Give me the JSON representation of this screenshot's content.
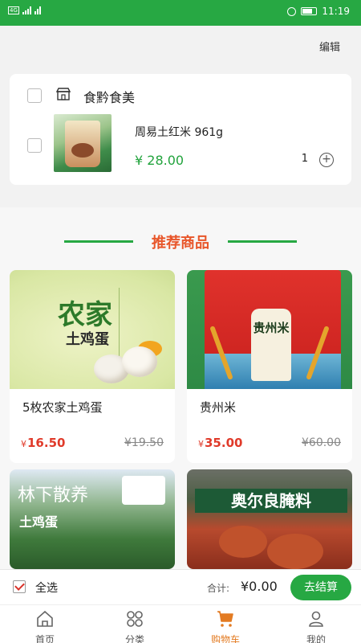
{
  "status_bar": {
    "time": "11:19",
    "network": "4G",
    "battery_label": "battery"
  },
  "header": {
    "edit_label": "编辑"
  },
  "cart": {
    "shop_name": "食黔食美",
    "items": [
      {
        "name": "周易土红米 961g",
        "price": "¥ 28.00",
        "quantity": "1",
        "plus": "+"
      }
    ]
  },
  "recommend": {
    "title": "推荐商品",
    "goods": [
      {
        "name": "5枚农家土鸡蛋",
        "price_symbol": "¥",
        "price": "16.50",
        "old_price": "¥19.50",
        "img_text_main": "农家",
        "img_text_sub": "土鸡蛋"
      },
      {
        "name": "贵州米",
        "price_symbol": "¥",
        "price": "35.00",
        "old_price": "¥60.00",
        "img_text_main": "贵州米"
      },
      {
        "name": "",
        "img_text_main": "林下散养",
        "img_text_sub": "土鸡蛋"
      },
      {
        "name": "",
        "img_text_main": "奥尔良腌料"
      }
    ]
  },
  "footer": {
    "select_all_label": "全选",
    "total_label": "合计:",
    "total_value": "¥0.00",
    "checkout_label": "去结算"
  },
  "tabs": [
    {
      "label": "首页",
      "icon": "home-icon"
    },
    {
      "label": "分类",
      "icon": "category-icon"
    },
    {
      "label": "购物车",
      "icon": "cart-icon",
      "active": true
    },
    {
      "label": "我的",
      "icon": "profile-icon"
    }
  ],
  "colors": {
    "brand_green": "#27a843",
    "accent_orange": "#e8562a",
    "price_red": "#e03a2a",
    "active_tab": "#e37b22"
  }
}
